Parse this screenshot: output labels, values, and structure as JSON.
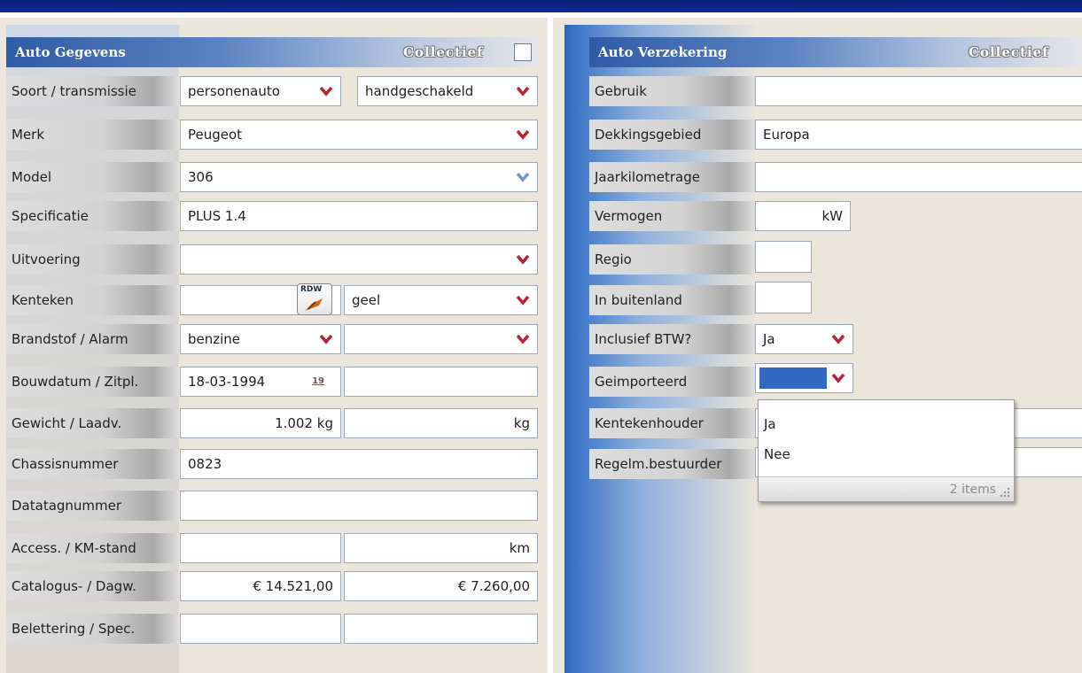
{
  "left": {
    "title": "Auto Gegevens",
    "collectief_label": "Collectief",
    "rows": {
      "soort": {
        "label": "Soort / transmissie",
        "value1": "personenauto",
        "value2": "handgeschakeld"
      },
      "merk": {
        "label": "Merk",
        "value": "Peugeot"
      },
      "model": {
        "label": "Model",
        "value": "306"
      },
      "specificatie": {
        "label": "Specificatie",
        "value": "PLUS 1.4"
      },
      "uitvoering": {
        "label": "Uitvoering",
        "value": ""
      },
      "kenteken": {
        "label": "Kenteken",
        "value": "",
        "rdw_label": "RDW",
        "color_value": "geel"
      },
      "brandstof": {
        "label": "Brandstof / Alarm",
        "value1": "benzine",
        "value2": ""
      },
      "bouwdatum": {
        "label": "Bouwdatum / Zitpl.",
        "value1": "18-03-1994",
        "cal_label": "19",
        "value2": ""
      },
      "gewicht": {
        "label": "Gewicht / Laadv.",
        "value1": "1.002 kg",
        "value2": "kg"
      },
      "chassis": {
        "label": "Chassisnummer",
        "value": "0823"
      },
      "datatag": {
        "label": "Datatagnummer",
        "value": ""
      },
      "access": {
        "label": "Access. / KM-stand",
        "value1": "",
        "value2": "km"
      },
      "catalogus": {
        "label": "Catalogus- / Dagw.",
        "value1": "€ 14.521,00",
        "value2": "€ 7.260,00"
      },
      "belettering": {
        "label": "Belettering / Spec.",
        "value1": "",
        "value2": ""
      }
    }
  },
  "right": {
    "title": "Auto Verzekering",
    "collectief_label": "Collectief",
    "rows": {
      "gebruik": {
        "label": "Gebruik",
        "value": ""
      },
      "dekking": {
        "label": "Dekkingsgebied",
        "value": "Europa"
      },
      "jaarkm": {
        "label": "Jaarkilometrage",
        "value": ""
      },
      "vermogen": {
        "label": "Vermogen",
        "value": "kW"
      },
      "regio": {
        "label": "Regio",
        "value": ""
      },
      "buitenland": {
        "label": "In buitenland",
        "value": ""
      },
      "btw": {
        "label": "Inclusief BTW?",
        "value": "Ja"
      },
      "geimporteerd": {
        "label": "Geimporteerd",
        "value": ""
      },
      "kentekenhouder": {
        "label": "Kentekenhouder",
        "value": ""
      },
      "regelm": {
        "label": "Regelm.bestuurder",
        "value": ""
      }
    },
    "dropdown": {
      "options": [
        "Ja",
        "Nee"
      ],
      "footer": "2 items"
    }
  },
  "colors": {
    "header_blue": "#2f5ca8",
    "top_bar": "#0f2a94",
    "arrow_red": "#b8233a",
    "selected_blue": "#316ac5"
  }
}
